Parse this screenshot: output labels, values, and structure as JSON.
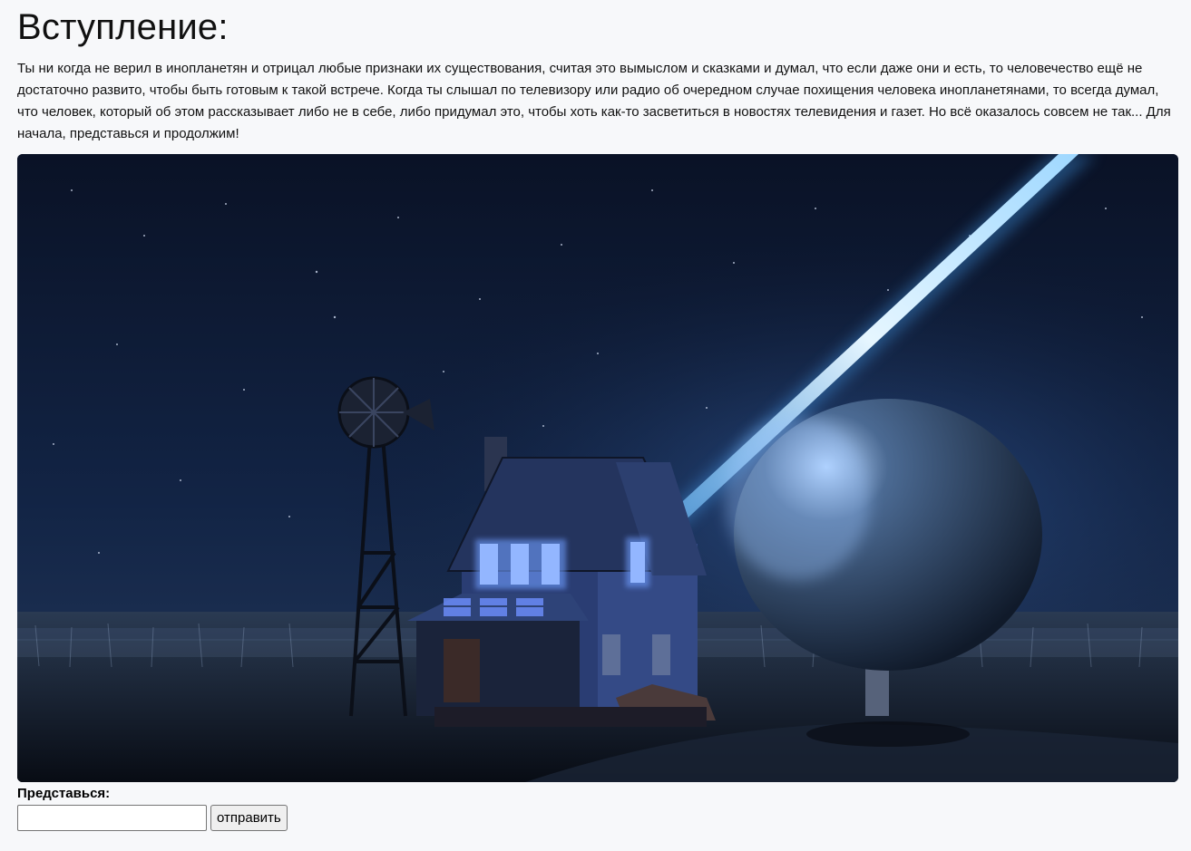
{
  "heading": "Вступление:",
  "intro_text": "Ты ни когда не верил в инопланетян и отрицал любые признаки их существования, считая это вымыслом и сказками и думал, что если даже они и есть, то человечество ещё не достаточно развито, чтобы быть готовым к такой встрече. Когда ты слышал по телевизору или радио об очередном случае похищения человека инопланетянами, то всегда думал, что человек, который об этом рассказывает либо не в себе, либо придумал это, чтобы хоть как-то засветиться в новостях телевидения и газет. Но всё оказалось совсем не так... Для начала, представься и продолжим!",
  "image": {
    "description_icon": "night-farm-abduction-beam-illustration"
  },
  "form": {
    "label": "Представься:",
    "input_value": "",
    "input_placeholder": "",
    "submit_label": "отправить"
  },
  "colors": {
    "background": "#f7f8fa",
    "beam": "#9fd8ff",
    "window_glow": "#c8dcff"
  }
}
